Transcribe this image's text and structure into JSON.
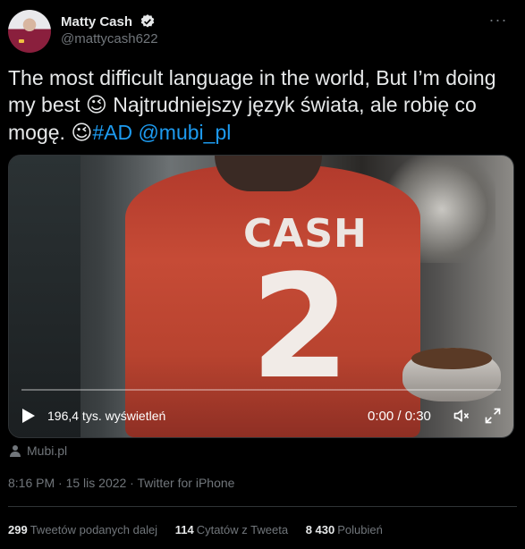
{
  "author": {
    "name": "Matty Cash",
    "handle": "@mattycash622"
  },
  "tweet": {
    "line1": "The most difficult language in the world, But I’m doing my best ",
    "emoji1": "😉",
    "line2": " Najtrudniejszy język świata, ale robię co mogę. ",
    "emoji2": "😉",
    "hashtag": "#AD",
    "mention": "@mubi_pl"
  },
  "video": {
    "jersey_name": "CASH",
    "jersey_number": "2",
    "views": "196,4 tys. wyświetleń",
    "time": "0:00 / 0:30"
  },
  "source": "Mubi.pl",
  "meta": "8:16 PM · 15 lis 2022 · Twitter for iPhone",
  "stats": {
    "retweets_count": "299",
    "retweets_label": "Tweetów podanych dalej",
    "quotes_count": "114",
    "quotes_label": "Cytatów z Tweeta",
    "likes_count": "8 430",
    "likes_label": "Polubień"
  },
  "colors": {
    "background": "#000000",
    "text": "#e7e9ea",
    "muted": "#71767b",
    "link": "#1d9bf0",
    "verified": "#e7e9ea"
  },
  "icons": [
    "verified-badge-icon",
    "more-options-icon",
    "play-icon",
    "volume-icon",
    "fullscreen-icon",
    "person-icon"
  ]
}
